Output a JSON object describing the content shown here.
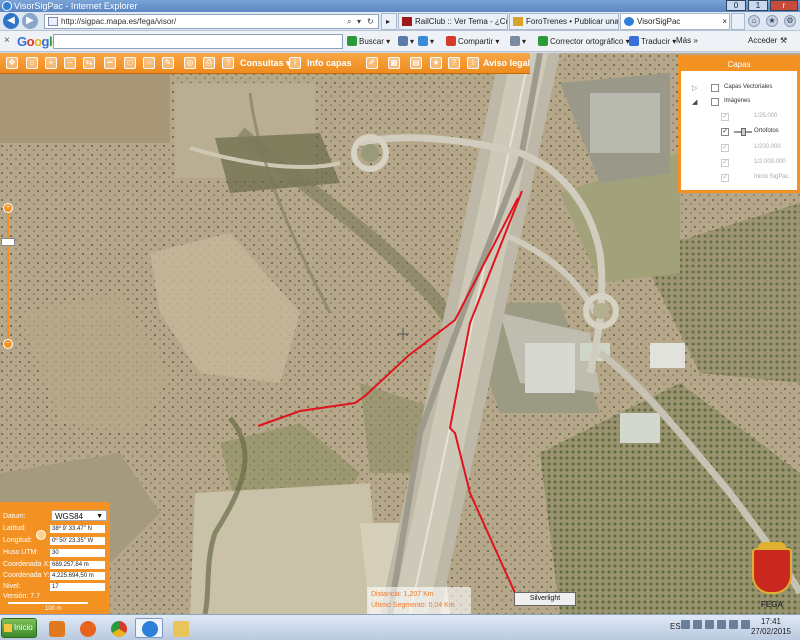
{
  "window": {
    "title": "VisorSigPac - Internet Explorer",
    "minimize": "0",
    "maximize": "1",
    "close": "r"
  },
  "address": {
    "url": "http://sigpac.mapa.es/fega/visor/",
    "search_icon": "search-icon",
    "refresh_icon": "refresh-icon"
  },
  "tabs": [
    {
      "label": "RailClub :: Ver Tema - ¿Cuá...",
      "active": false
    },
    {
      "label": "ForoTrenes • Publicar una r...",
      "active": false
    },
    {
      "label": "VisorSigPac",
      "active": true
    }
  ],
  "google_toolbar": {
    "logo": "Google",
    "search_placeholder": "",
    "search_button": "Buscar",
    "share": "Compartir",
    "spellcheck": "Corrector ortográfico",
    "translate": "Traducir",
    "more": "Más",
    "signin": "Acceder"
  },
  "map_toolbar": {
    "consultas": "Consultas",
    "info_capas": "Info capas",
    "aviso_legal": "Aviso legal"
  },
  "layers_panel": {
    "title": "Capas",
    "items": [
      {
        "label": "Capas Vectoriales",
        "checked": false,
        "enabled": true
      },
      {
        "label": "Imágenes",
        "checked": false,
        "enabled": true
      },
      {
        "label": "1/25.000",
        "checked": true,
        "enabled": false
      },
      {
        "label": "Ortofotos",
        "checked": true,
        "enabled": true
      },
      {
        "label": "1/200.000",
        "checked": true,
        "enabled": false
      },
      {
        "label": "1/2.000.000",
        "checked": true,
        "enabled": false
      },
      {
        "label": "Inicio SigPac",
        "checked": true,
        "enabled": false
      }
    ]
  },
  "coords_panel": {
    "datum_label": "Datum:",
    "datum_value": "WGS84",
    "latitud_label": "Latitud:",
    "latitud_value": "38º 9' 33.47'' N",
    "longitud_label": "Longitud:",
    "longitud_value": "0º 50' 23.35'' W",
    "huso_label": "Huso UTM:",
    "huso_value": "30",
    "cx_label": "Coordenada X:",
    "cx_value": "689.257,84 m",
    "cy_label": "Coordenada Y:",
    "cy_value": "4.225.694,50 m",
    "nivel_label": "Nivel:",
    "nivel_value": "17",
    "version": "Versión: 7.7",
    "scale": "100 m"
  },
  "measurement": {
    "distance": "Distancia: 1,207 Km",
    "last_segment": "Último Segmento: 0,04 Km"
  },
  "silverlight_label": "Silverlight",
  "logo_text": "FEGA",
  "taskbar": {
    "start_label": "Inicio",
    "language": "ES",
    "time": "17:41",
    "date": "27/02/2015"
  },
  "colors": {
    "accent": "#f39223",
    "measure_line": "#e0141e"
  }
}
